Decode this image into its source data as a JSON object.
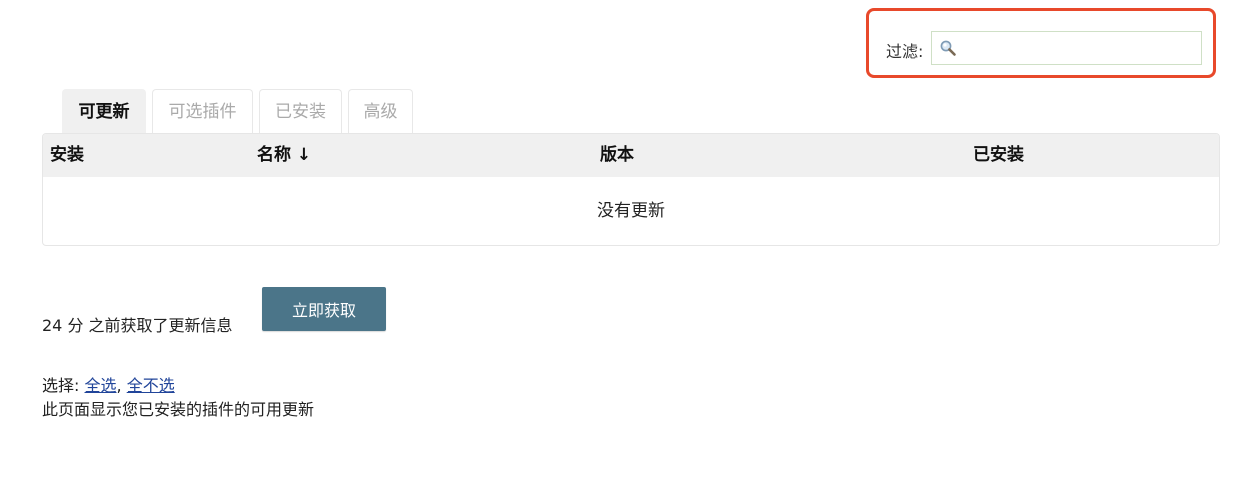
{
  "filter": {
    "label": "过滤:",
    "value": "",
    "placeholder": ""
  },
  "tabs": [
    {
      "label": "可更新",
      "active": true
    },
    {
      "label": "可选插件",
      "active": false
    },
    {
      "label": "已安装",
      "active": false
    },
    {
      "label": "高级",
      "active": false
    }
  ],
  "table": {
    "headers": {
      "install": "安装",
      "name": "名称 ↓",
      "version": "版本",
      "installed": "已安装"
    },
    "empty_message": "没有更新"
  },
  "status": {
    "text": "24 分 之前获取了更新信息",
    "fetch_button": "立即获取"
  },
  "select": {
    "label": "选择:",
    "all": "全选",
    "separator": ",",
    "none": "全不选"
  },
  "description": "此页面显示您已安装的插件的可用更新",
  "colors": {
    "highlight": "#e8492b",
    "button": "#4b7589",
    "link": "#21459a"
  }
}
